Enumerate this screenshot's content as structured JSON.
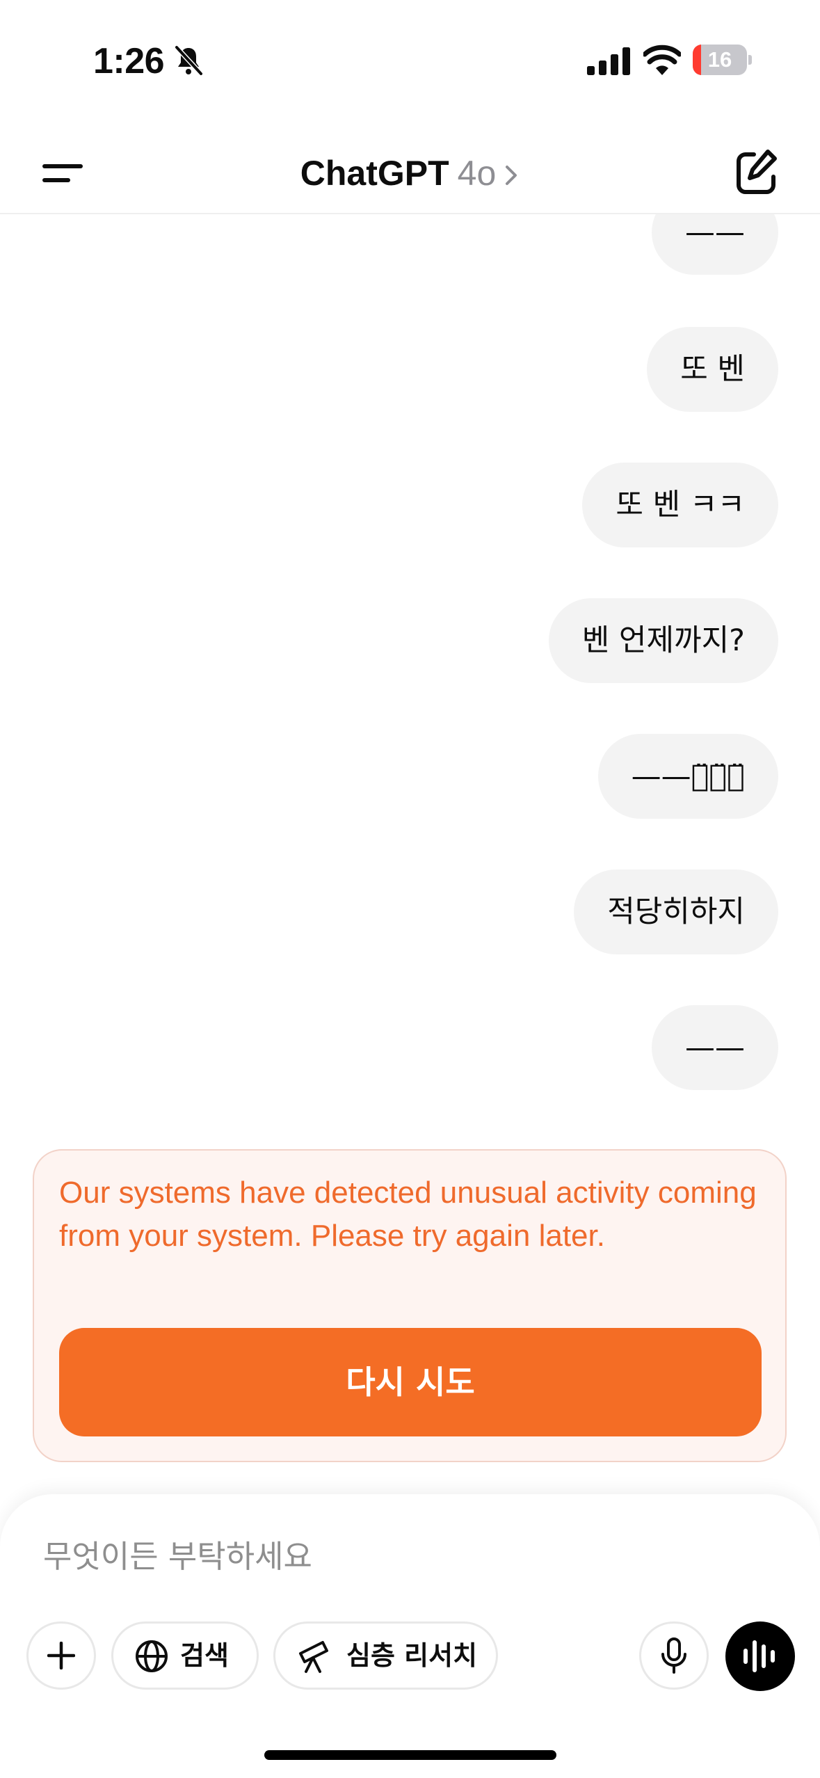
{
  "status_bar": {
    "time": "1:26",
    "battery_level": "16",
    "battery_color": "#ff3b30",
    "icons": [
      "bell-slash-icon",
      "cellular-signal-icon",
      "wifi-icon",
      "battery-icon"
    ]
  },
  "header": {
    "title": "ChatGPT",
    "model": "4o",
    "icons": [
      "menu-icon",
      "chevron-right-icon",
      "new-chat-icon"
    ]
  },
  "messages": [
    {
      "role": "user",
      "text": "——"
    },
    {
      "role": "user",
      "text": "또 벤"
    },
    {
      "role": "user",
      "text": "또 벤 ㅋㅋ"
    },
    {
      "role": "user",
      "text": "벤 언제까지?"
    },
    {
      "role": "user",
      "text": "——ㅋ̈ㅋ̈ㅋ̈"
    },
    {
      "role": "user",
      "text": "적당히하지"
    },
    {
      "role": "user",
      "text": "——"
    }
  ],
  "error": {
    "message": "Our systems have detected unusual activity coming from your system. Please try again later.",
    "retry_label": "다시 시도",
    "accent_color": "#f46d25"
  },
  "composer": {
    "placeholder": "무엇이든 부탁하세요",
    "search_label": "검색",
    "deep_research_label": "심층 리서치",
    "icons": [
      "plus-icon",
      "globe-icon",
      "telescope-icon",
      "microphone-icon",
      "voice-mode-icon"
    ]
  }
}
